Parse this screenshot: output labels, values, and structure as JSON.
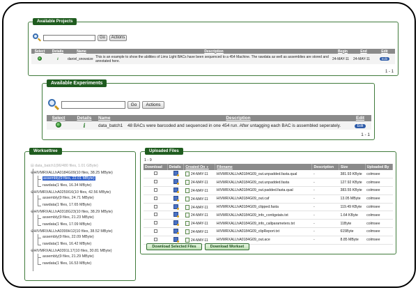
{
  "projects": {
    "legend": "Available Projects",
    "search_button": "Go",
    "actions_button": "Actions",
    "columns": [
      "Select",
      "Details",
      "Name",
      "Description",
      "Begin",
      "End",
      "Edit"
    ],
    "rows": [
      {
        "name": "daniel_snowsize",
        "description": "This is an example to show the abilities of Lims Light BACs have been sequenced to a 454 Machine. The rawdata as well as assemblies are stored and annotated here.",
        "begin": "24-MAY-11",
        "end": "24-MAY-11",
        "edit": "Edit"
      }
    ],
    "pager": "1 - 1"
  },
  "experiments": {
    "legend": "Available Experiments",
    "search_button": "Go",
    "actions_button": "Actions",
    "columns": [
      "Select",
      "Details",
      "Name",
      "Description",
      "Edit"
    ],
    "rows": [
      {
        "name": "data_batch1",
        "description": "48 BACs were barcoded and sequenced in one 454 run. After untagging each BAC is assembled seperately.",
        "edit": "Edit"
      }
    ],
    "pager": "1 - 1"
  },
  "worksettree": {
    "legend": "Worksettree",
    "root": "data_batch1(96/480 files, 1.01 GByte)",
    "nodes": [
      {
        "label": "HIVMRXALLhA0184G09(10 files, 38.25 MByte)",
        "children": [
          "assembly(9 files, 22.01 MByte)",
          "rawdata(1 files, 16.34 MByte)"
        ],
        "selected_child": 0
      },
      {
        "label": "HIVMRXALLhA0259I16(10 files, 42.56 MByte)",
        "children": [
          "assembly(9 files, 24.71 MByte)",
          "rawdata(1 files, 17.65 MByte)"
        ]
      },
      {
        "label": "HIVMRXALLhA0318G23(10 files, 38.29 MByte)",
        "children": [
          "assembly(9 files, 21.23 MByte)",
          "rawdata(1 files, 17.09 MByte)"
        ]
      },
      {
        "label": "HIVMRXALLhA0399H12(10 files, 38.52 MByte)",
        "children": [
          "assembly(9 files, 22.09 MByte)",
          "rawdata(1 files, 16.42 MByte)"
        ]
      },
      {
        "label": "HIVMRXALLhA0391L17(10 files, 30.81 MByte)",
        "children": [
          "assembly(9 files, 21.29 MByte)",
          "rawdata(1 files, 16.53 MByte)"
        ]
      }
    ]
  },
  "uploaded": {
    "legend": "Uploaded Files",
    "range": "1 - 9",
    "columns": [
      "Download",
      "Details",
      "Created On",
      "Filename",
      "Description",
      "Size",
      "Uploaded By"
    ],
    "sort_indicator": "▼",
    "rows": [
      {
        "created": "24-MAY-11",
        "filename": "HIVMRXALLhA0184G09_out.unpadded.fasta.qual",
        "description": "-",
        "size": "381.93 KByte",
        "by": "colmsee"
      },
      {
        "created": "24-MAY-11",
        "filename": "HIVMRXALLhA0184G09_out.unpadded.fasta",
        "description": "-",
        "size": "127.92 KByte",
        "by": "colmsee"
      },
      {
        "created": "24-MAY-11",
        "filename": "HIVMRXALLhA0184G09_out.padded.fasta.qual",
        "description": "-",
        "size": "383.55 KByte",
        "by": "colmsee"
      },
      {
        "created": "24-MAY-11",
        "filename": "HIVMRXALLhA0184G09_out.caf",
        "description": "-",
        "size": "13.05 MByte",
        "by": "colmsee"
      },
      {
        "created": "24-MAY-11",
        "filename": "HIVMRXALLhA0184G09_clipped.fasta",
        "description": "-",
        "size": "119.49 KByte",
        "by": "colmsee"
      },
      {
        "created": "24-MAY-11",
        "filename": "HIVMRXALLhA0184G09_info_contigstats.txt",
        "description": "-",
        "size": "1.64 KByte",
        "by": "colmsee"
      },
      {
        "created": "24-MAY-11",
        "filename": "HIVMRXALLhA0184G09_info_callparameters.txt",
        "description": "-",
        "size": "11Byte",
        "by": "colmsee"
      },
      {
        "created": "24-MAY-11",
        "filename": "HIVMRXALLhA0184G09_clipReport.txt",
        "description": "-",
        "size": "615Byte",
        "by": "colmsee"
      },
      {
        "created": "24-MAY-11",
        "filename": "HIVMRXALLhA0184G09_out.ace",
        "description": "-",
        "size": "8.85 MByte",
        "by": "colmsee"
      }
    ],
    "download_selected": "Download Selected Files",
    "download_workset": "Download Workset"
  }
}
